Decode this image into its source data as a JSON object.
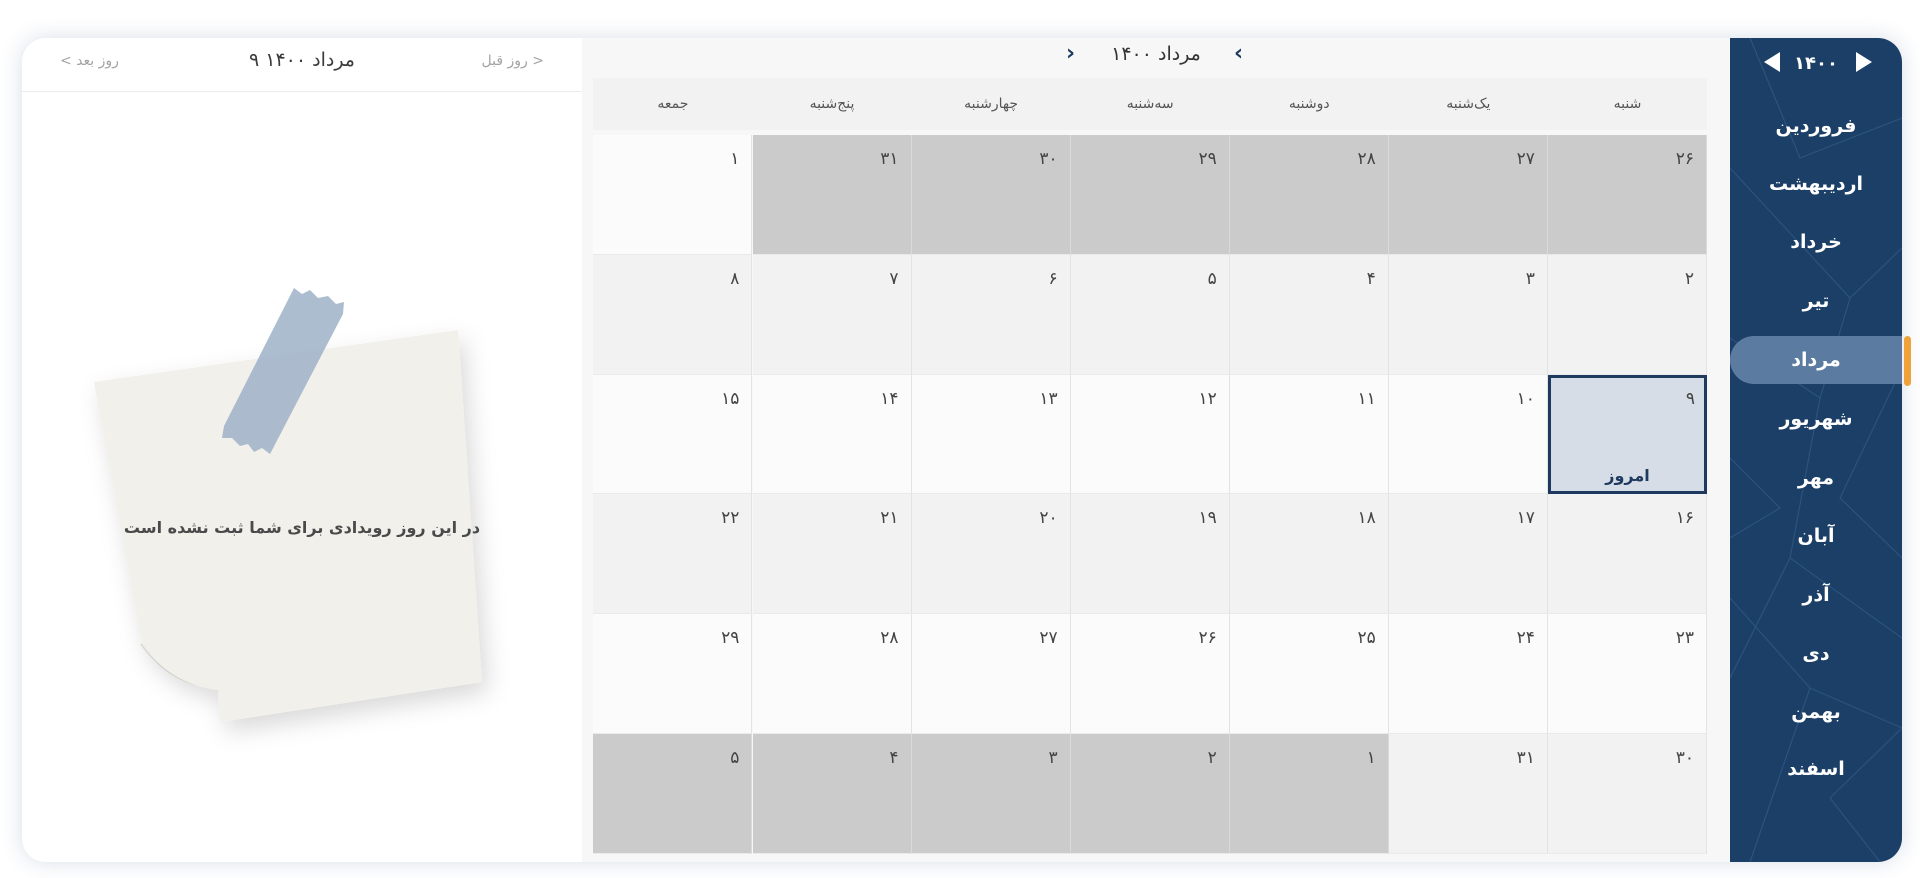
{
  "day_panel": {
    "title": "۹ مرداد ۱۴۰۰",
    "prev_day": "روز قبل >",
    "next_day": "< روز بعد",
    "empty_message": "در این روز رویدادی برای شما ثبت نشده است"
  },
  "calendar": {
    "title": "مرداد ۱۴۰۰",
    "weekdays": [
      "شنبه",
      "یک‌شنبه",
      "دوشنبه",
      "سه‌شنبه",
      "چهارشنبه",
      "پنج‌شنبه",
      "جمعه"
    ],
    "today_label": "امروز",
    "weeks": [
      [
        {
          "d": "۲۶",
          "out": true
        },
        {
          "d": "۲۷",
          "out": true
        },
        {
          "d": "۲۸",
          "out": true
        },
        {
          "d": "۲۹",
          "out": true
        },
        {
          "d": "۳۰",
          "out": true
        },
        {
          "d": "۳۱",
          "out": true
        },
        {
          "d": "۱",
          "out": false
        }
      ],
      [
        {
          "d": "۲",
          "out": false
        },
        {
          "d": "۳",
          "out": false
        },
        {
          "d": "۴",
          "out": false
        },
        {
          "d": "۵",
          "out": false
        },
        {
          "d": "۶",
          "out": false
        },
        {
          "d": "۷",
          "out": false
        },
        {
          "d": "۸",
          "out": false
        }
      ],
      [
        {
          "d": "۹",
          "out": false,
          "today": true
        },
        {
          "d": "۱۰",
          "out": false
        },
        {
          "d": "۱۱",
          "out": false
        },
        {
          "d": "۱۲",
          "out": false
        },
        {
          "d": "۱۳",
          "out": false
        },
        {
          "d": "۱۴",
          "out": false
        },
        {
          "d": "۱۵",
          "out": false
        }
      ],
      [
        {
          "d": "۱۶",
          "out": false
        },
        {
          "d": "۱۷",
          "out": false
        },
        {
          "d": "۱۸",
          "out": false
        },
        {
          "d": "۱۹",
          "out": false
        },
        {
          "d": "۲۰",
          "out": false
        },
        {
          "d": "۲۱",
          "out": false
        },
        {
          "d": "۲۲",
          "out": false
        }
      ],
      [
        {
          "d": "۲۳",
          "out": false
        },
        {
          "d": "۲۴",
          "out": false
        },
        {
          "d": "۲۵",
          "out": false
        },
        {
          "d": "۲۶",
          "out": false
        },
        {
          "d": "۲۷",
          "out": false
        },
        {
          "d": "۲۸",
          "out": false
        },
        {
          "d": "۲۹",
          "out": false
        }
      ],
      [
        {
          "d": "۳۰",
          "out": false
        },
        {
          "d": "۳۱",
          "out": false
        },
        {
          "d": "۱",
          "out": true
        },
        {
          "d": "۲",
          "out": true
        },
        {
          "d": "۳",
          "out": true
        },
        {
          "d": "۴",
          "out": true
        },
        {
          "d": "۵",
          "out": true
        }
      ]
    ]
  },
  "sidebar": {
    "year": "۱۴۰۰",
    "months": [
      "فروردین",
      "اردیبهشت",
      "خرداد",
      "تیر",
      "مرداد",
      "شهریور",
      "مهر",
      "آبان",
      "آذر",
      "دی",
      "بهمن",
      "اسفند"
    ],
    "active_month": "مرداد"
  },
  "colors": {
    "sidebar_bg": "#1b3f66",
    "active_month_bg": "#5b7ca0",
    "active_indicator": "#f0a23a",
    "out_of_month_cell": "#cbcbcb",
    "today_border": "#1e3a5f"
  },
  "icons": [
    "chevron-left-icon",
    "chevron-right-icon",
    "triangle-left-icon",
    "triangle-right-icon",
    "sticky-note-icon",
    "tape-icon"
  ]
}
